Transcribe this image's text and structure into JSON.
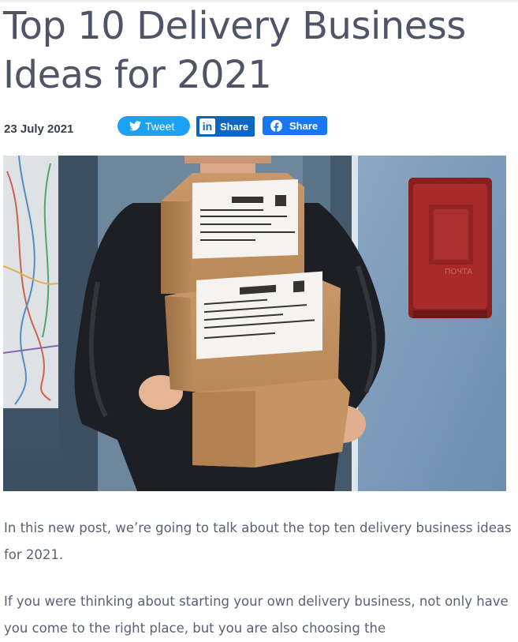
{
  "article": {
    "title": "Top 10 Delivery Business Ideas for 2021",
    "date": "23 July 2021",
    "share": {
      "tweet_label": "Tweet",
      "linkedin_label": "Share",
      "facebook_label": "Share",
      "colors": {
        "twitter": "#1da1f2",
        "linkedin": "#0a66c2",
        "facebook": "#1877f2"
      }
    },
    "hero_image_icon": "delivery-person-carrying-boxes-photo",
    "paragraphs": [
      "In this new post, we’re going to talk about the top ten delivery business ideas for 2021.",
      "If you were thinking about starting your own delivery business, not only have you come to the right place, but you are also choosing the"
    ]
  }
}
